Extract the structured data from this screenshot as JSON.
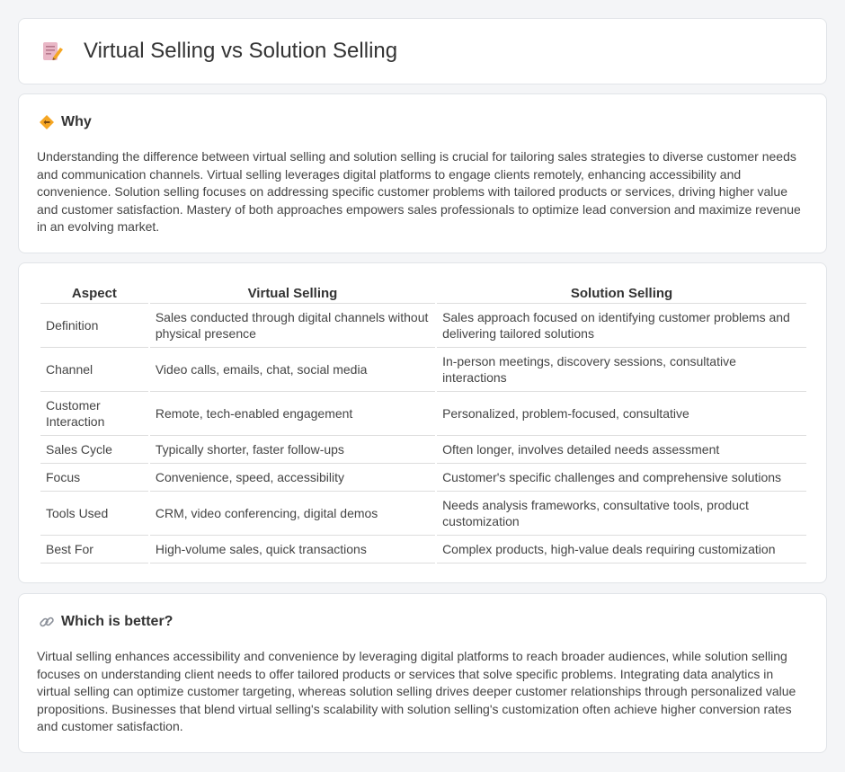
{
  "page": {
    "title": "Virtual Selling vs Solution Selling",
    "icon": "document-pencil-icon"
  },
  "why": {
    "icon": "diamond-sign-icon",
    "heading": "Why",
    "text": "Understanding the difference between virtual selling and solution selling is crucial for tailoring sales strategies to diverse customer needs and communication channels. Virtual selling leverages digital platforms to engage clients remotely, enhancing accessibility and convenience. Solution selling focuses on addressing specific customer problems with tailored products or services, driving higher value and customer satisfaction. Mastery of both approaches empowers sales professionals to optimize lead conversion and maximize revenue in an evolving market."
  },
  "table": {
    "headers": [
      "Aspect",
      "Virtual Selling",
      "Solution Selling"
    ],
    "rows": [
      [
        "Definition",
        "Sales conducted through digital channels without physical presence",
        "Sales approach focused on identifying customer problems and delivering tailored solutions"
      ],
      [
        "Channel",
        "Video calls, emails, chat, social media",
        "In-person meetings, discovery sessions, consultative interactions"
      ],
      [
        "Customer Interaction",
        "Remote, tech-enabled engagement",
        "Personalized, problem-focused, consultative"
      ],
      [
        "Sales Cycle",
        "Typically shorter, faster follow-ups",
        "Often longer, involves detailed needs assessment"
      ],
      [
        "Focus",
        "Convenience, speed, accessibility",
        "Customer's specific challenges and comprehensive solutions"
      ],
      [
        "Tools Used",
        "CRM, video conferencing, digital demos",
        "Needs analysis frameworks, consultative tools, product customization"
      ],
      [
        "Best For",
        "High-volume sales, quick transactions",
        "Complex products, high-value deals requiring customization"
      ]
    ]
  },
  "better": {
    "icon": "link-icon",
    "heading": "Which is better?",
    "text": "Virtual selling enhances accessibility and convenience by leveraging digital platforms to reach broader audiences, while solution selling focuses on understanding client needs to offer tailored products or services that solve specific problems. Integrating data analytics in virtual selling can optimize customer targeting, whereas solution selling drives deeper customer relationships through personalized value propositions. Businesses that blend virtual selling's scalability with solution selling's customization often achieve higher conversion rates and customer satisfaction."
  },
  "colors": {
    "background": "#f4f5f7",
    "card": "#ffffff",
    "border": "#e1e4e8",
    "accent_orange": "#f5a623",
    "icon_pink": "#e8a0b4"
  }
}
